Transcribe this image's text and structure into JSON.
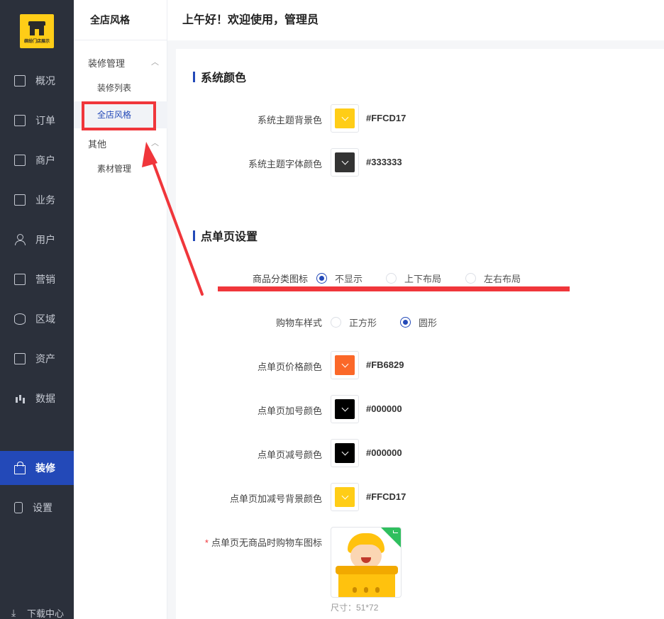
{
  "logo": {
    "text": "缤纷门店展示"
  },
  "sidebar": {
    "items": [
      {
        "label": "概况",
        "icon": "dashboard-icon",
        "active": false
      },
      {
        "label": "订单",
        "icon": "order-icon",
        "active": false
      },
      {
        "label": "商户",
        "icon": "merchant-icon",
        "active": false
      },
      {
        "label": "业务",
        "icon": "business-icon",
        "active": false
      },
      {
        "label": "用户",
        "icon": "user-icon",
        "active": false
      },
      {
        "label": "营销",
        "icon": "marketing-icon",
        "active": false
      },
      {
        "label": "区域",
        "icon": "region-icon",
        "active": false
      },
      {
        "label": "资产",
        "icon": "asset-icon",
        "active": false
      },
      {
        "label": "数据",
        "icon": "chart-icon",
        "active": false
      },
      {
        "label": "装修",
        "icon": "bag-icon",
        "active": true
      },
      {
        "label": "设置",
        "icon": "settings-icon",
        "active": false
      }
    ],
    "download": "下载中心"
  },
  "submenu": {
    "title": "全店风格",
    "groups": [
      {
        "label": "装修管理",
        "items": [
          "装修列表",
          "全店风格"
        ]
      },
      {
        "label": "其他",
        "items": [
          "素材管理"
        ]
      }
    ],
    "active_item": "全店风格"
  },
  "header": {
    "greeting": "上午好！欢迎使用，管理员"
  },
  "colors": {
    "accent": "#2349b8",
    "annotation": "#f0363b"
  },
  "system_colors": {
    "title": "系统颜色",
    "bg": {
      "label": "系统主题背景色",
      "value": "#FFCD17"
    },
    "font": {
      "label": "系统主题字体颜色",
      "value": "#333333"
    }
  },
  "order_page": {
    "title": "点单页设置",
    "category_icon": {
      "label": "商品分类图标",
      "options": [
        "不显示",
        "上下布局",
        "左右布局"
      ],
      "selected": "不显示"
    },
    "cart_style": {
      "label": "购物车样式",
      "options": [
        "正方形",
        "圆形"
      ],
      "selected": "圆形"
    },
    "price_color": {
      "label": "点单页价格颜色",
      "value": "#FB6829"
    },
    "plus_color": {
      "label": "点单页加号颜色",
      "value": "#000000"
    },
    "minus_color": {
      "label": "点单页减号颜色",
      "value": "#000000"
    },
    "plusminus_bg": {
      "label": "点单页加减号背景颜色",
      "value": "#FFCD17"
    },
    "empty_cart_icon": {
      "label": "点单页无商品时购物车图标",
      "required_mark": "*",
      "size_note": "尺寸：51*72"
    }
  }
}
